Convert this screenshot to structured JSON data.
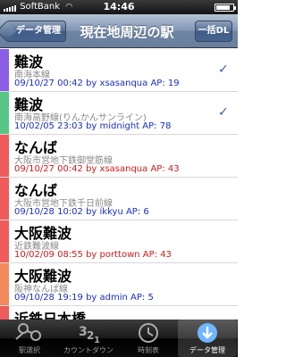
{
  "status_bar": {
    "carrier": "SoftBank",
    "time": "14:46",
    "battery_level": 0.85
  },
  "nav": {
    "back_label": "データ管理",
    "title": "現在地周辺の駅",
    "right_label": "一括DL"
  },
  "stations": [
    {
      "name": "難波",
      "line": "南海本線",
      "info": "09/10/27 00:42 by xsasanqua  AP: 19",
      "color": "#8a5fe6",
      "info_color": "blue",
      "checked": true
    },
    {
      "name": "難波",
      "line": "南海高野線(りんかんサンライン)",
      "info": "10/02/05 23:03 by midnight  AP: 78",
      "color": "#58c785",
      "info_color": "blue",
      "checked": true
    },
    {
      "name": "なんば",
      "line": "大阪市営地下鉄御堂筋線",
      "info": "09/10/27 00:42 by xsasanqua  AP: 43",
      "color": "#ef5a5a",
      "info_color": "red",
      "checked": false
    },
    {
      "name": "なんば",
      "line": "大阪市営地下鉄千日前線",
      "info": "09/10/28 10:02 by ikkyu  AP: 6",
      "color": "#ef5a5a",
      "info_color": "blue",
      "checked": false
    },
    {
      "name": "大阪難波",
      "line": "近鉄難波線",
      "info": "10/02/09 08:55 by porttown  AP: 43",
      "color": "#ef5a5a",
      "info_color": "red",
      "checked": false
    },
    {
      "name": "大阪難波",
      "line": "阪神なんば線",
      "info": "09/10/28 19:19 by admin  AP: 5",
      "color": "#f28a5c",
      "info_color": "blue",
      "checked": false
    },
    {
      "name": "近鉄日本橋",
      "line": "",
      "info": "",
      "color": "#ef5a5a",
      "info_color": "blue",
      "checked": false
    }
  ],
  "tabs": [
    {
      "label": "駅選択",
      "icon": "station-select-icon",
      "active": false
    },
    {
      "label": "カウントダウン",
      "icon": "countdown-icon",
      "active": false
    },
    {
      "label": "時刻表",
      "icon": "timetable-icon",
      "active": false
    },
    {
      "label": "データ管理",
      "icon": "download-icon",
      "active": true
    }
  ]
}
